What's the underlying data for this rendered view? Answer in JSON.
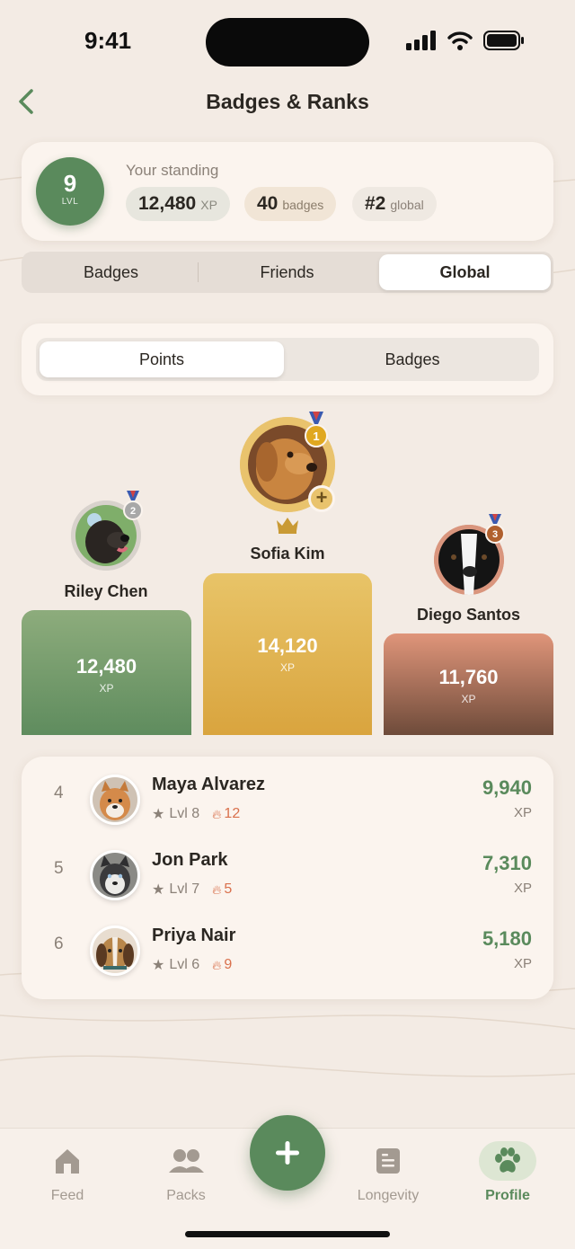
{
  "status_bar": {
    "time": "9:41"
  },
  "header": {
    "title": "Badges & Ranks"
  },
  "standing": {
    "level": "9",
    "level_label": "LVL",
    "label": "Your standing",
    "xp_value": "12,480",
    "xp_unit": "XP",
    "badges_value": "40",
    "badges_unit": "badges",
    "rank_value": "#2",
    "rank_unit": "global"
  },
  "tabs": [
    {
      "label": "Badges",
      "active": false
    },
    {
      "label": "Friends",
      "active": false
    },
    {
      "label": "Global",
      "active": true
    }
  ],
  "sub_tabs": [
    {
      "label": "Points",
      "active": true
    },
    {
      "label": "Badges",
      "active": false
    }
  ],
  "podium": {
    "first": {
      "rank": "1",
      "name": "Sofia Kim",
      "xp": "14,120",
      "xp_unit": "XP"
    },
    "second": {
      "rank": "2",
      "name": "Riley Chen",
      "xp": "12,480",
      "xp_unit": "XP"
    },
    "third": {
      "rank": "3",
      "name": "Diego Santos",
      "xp": "11,760",
      "xp_unit": "XP"
    }
  },
  "leaderboard": [
    {
      "rank": "4",
      "name": "Maya Alvarez",
      "level": "Lvl 8",
      "streak": "12",
      "xp": "9,940",
      "xp_unit": "XP"
    },
    {
      "rank": "5",
      "name": "Jon Park",
      "level": "Lvl 7",
      "streak": "5",
      "xp": "7,310",
      "xp_unit": "XP"
    },
    {
      "rank": "6",
      "name": "Priya Nair",
      "level": "Lvl 6",
      "streak": "9",
      "xp": "5,180",
      "xp_unit": "XP"
    }
  ],
  "nav": [
    {
      "label": "Feed",
      "icon": "home-icon",
      "active": false
    },
    {
      "label": "Packs",
      "icon": "people-icon",
      "active": false
    },
    {
      "label": "Longevity",
      "icon": "clipboard-icon",
      "active": false
    },
    {
      "label": "Profile",
      "icon": "paw-icon",
      "active": true
    }
  ],
  "colors": {
    "background": "#f3ebe4",
    "accent_green": "#5a8a5c",
    "gold": "#e1b44f",
    "bronze": "#c07a62",
    "streak": "#d9704c"
  }
}
